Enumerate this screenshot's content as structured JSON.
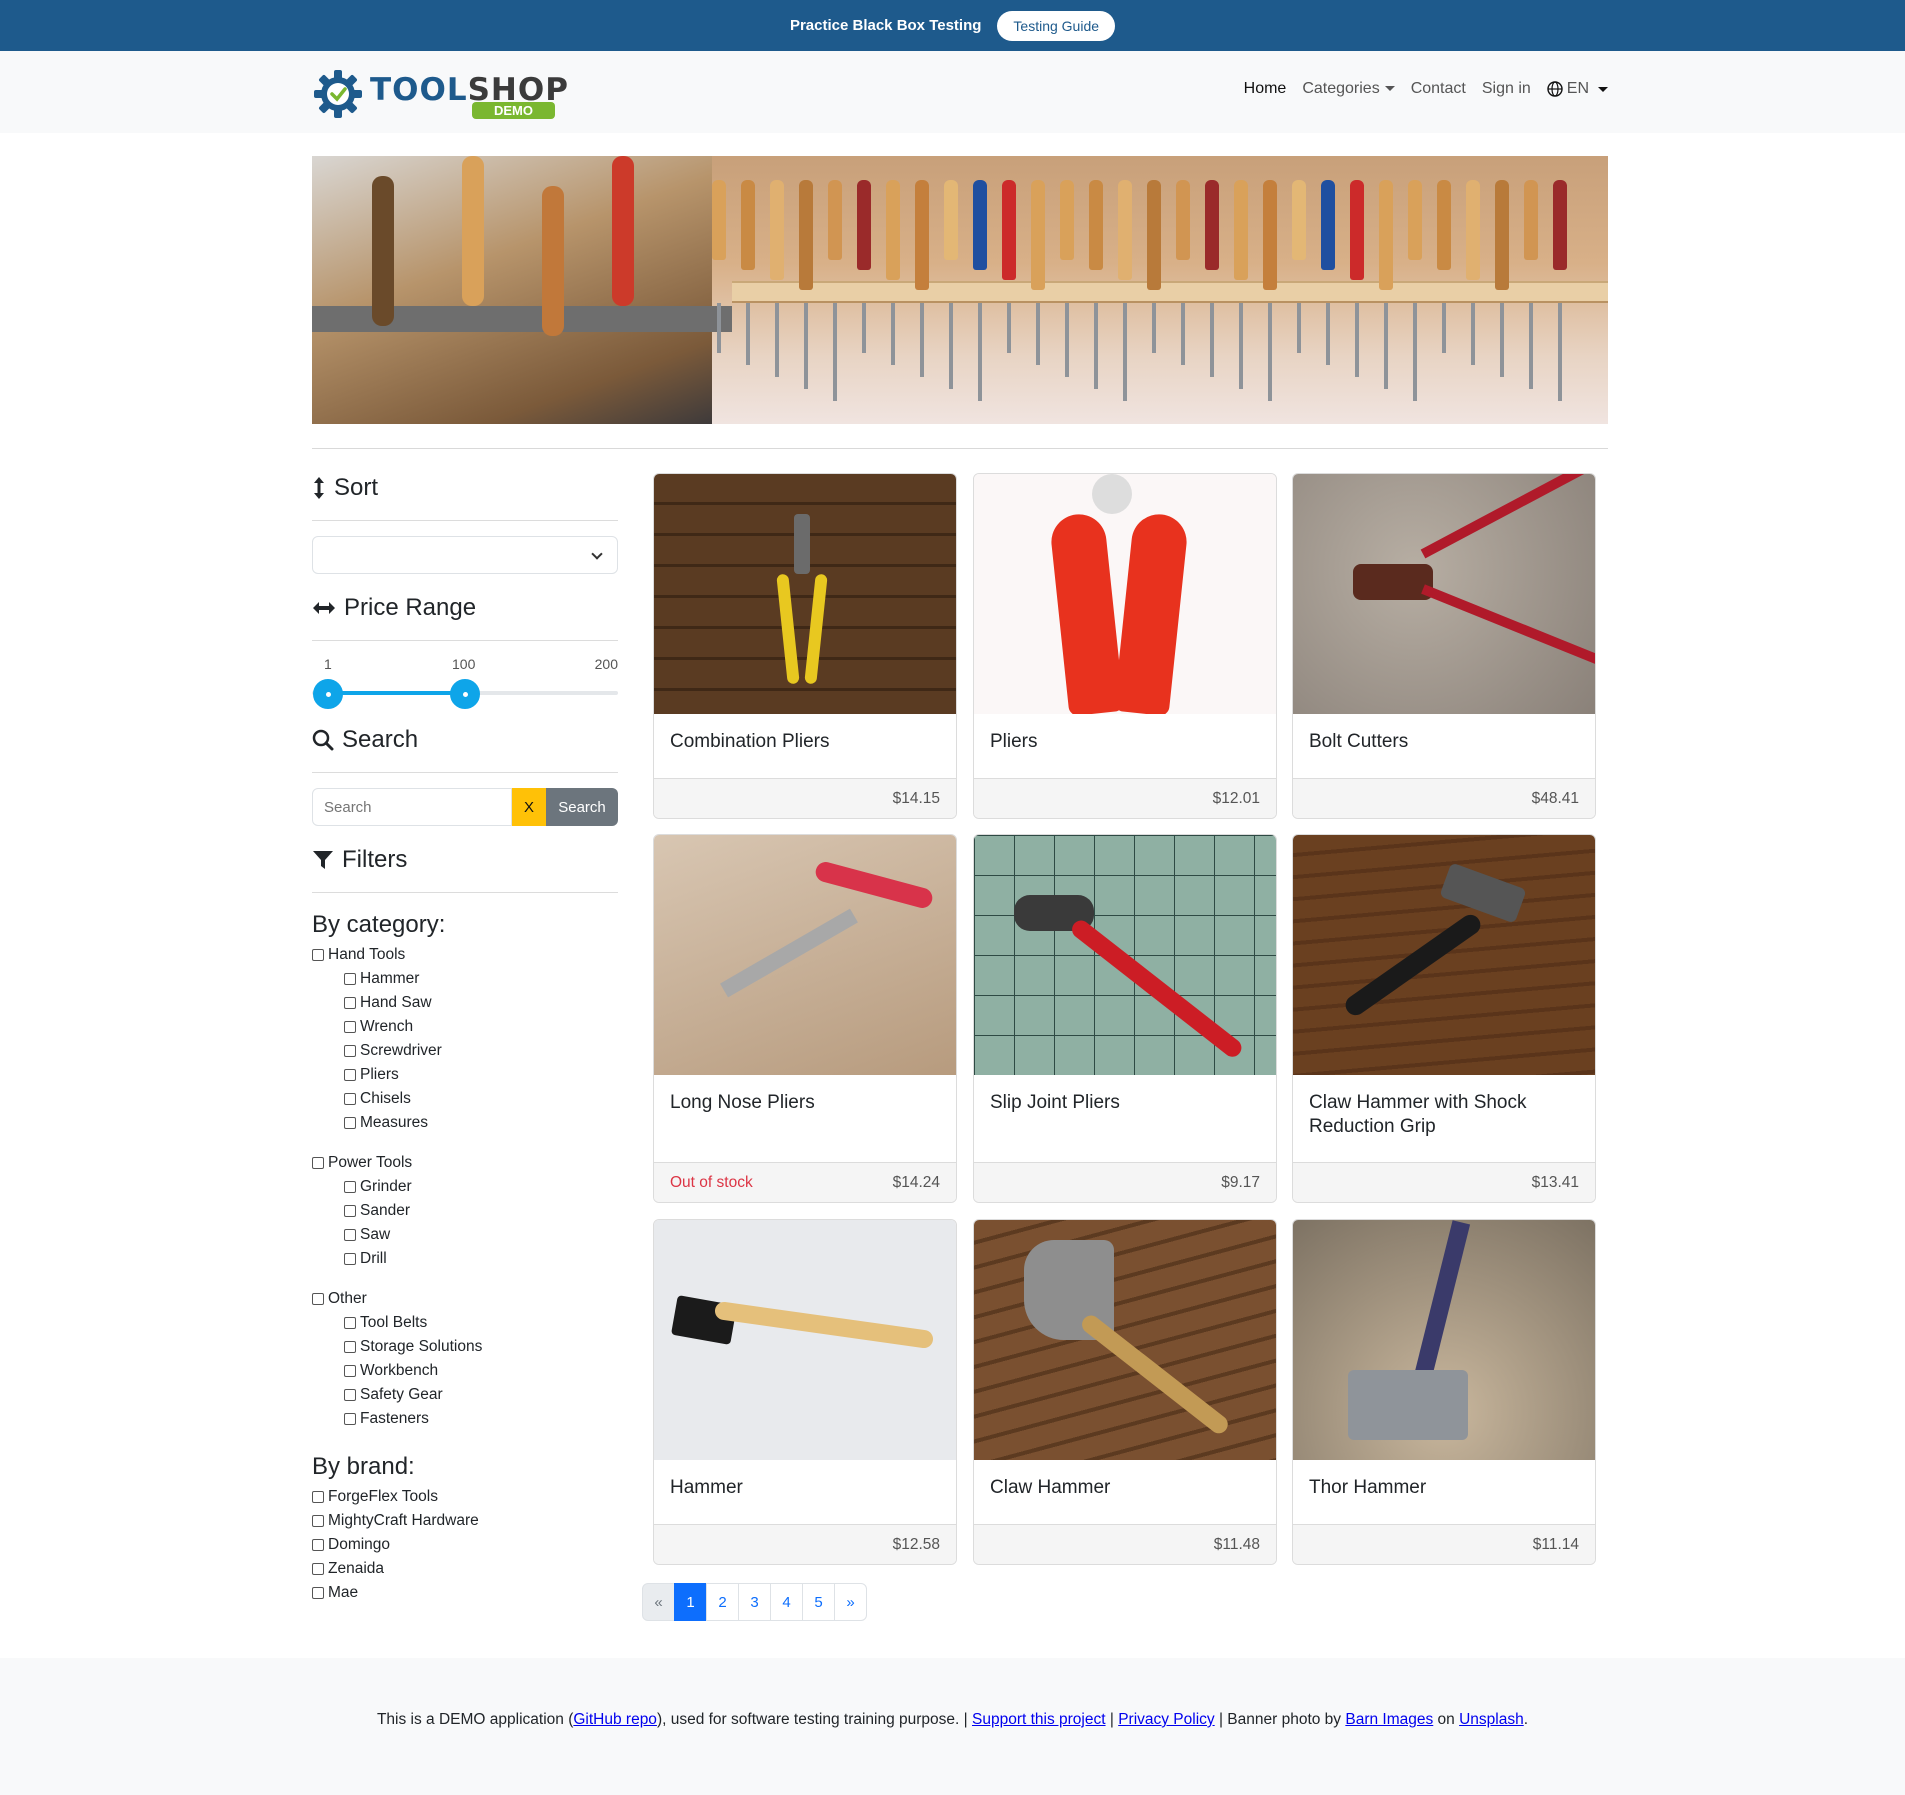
{
  "topbar": {
    "text": "Practice Black Box Testing",
    "button": "Testing Guide"
  },
  "logo": {
    "part1": "TOOL",
    "part2": "SHOP",
    "badge": "DEMO"
  },
  "nav": {
    "home": "Home",
    "categories": "Categories",
    "contact": "Contact",
    "signin": "Sign in",
    "lang": "EN"
  },
  "sidebar": {
    "sort_title": "Sort",
    "price_title": "Price Range",
    "price": {
      "min_label": "1",
      "max_sel": "100",
      "max_label": "200",
      "min_value": 1,
      "max_value": 100
    },
    "search_title": "Search",
    "search_placeholder": "Search",
    "clear_label": "X",
    "search_btn": "Search",
    "filters_title": "Filters",
    "by_category": "By category:",
    "categories": {
      "hand": {
        "label": "Hand Tools",
        "subs": [
          "Hammer",
          "Hand Saw",
          "Wrench",
          "Screwdriver",
          "Pliers",
          "Chisels",
          "Measures"
        ]
      },
      "power": {
        "label": "Power Tools",
        "subs": [
          "Grinder",
          "Sander",
          "Saw",
          "Drill"
        ]
      },
      "other": {
        "label": "Other",
        "subs": [
          "Tool Belts",
          "Storage Solutions",
          "Workbench",
          "Safety Gear",
          "Fasteners"
        ]
      }
    },
    "by_brand": "By brand:",
    "brands": [
      "ForgeFlex Tools",
      "MightyCraft Hardware",
      "Domingo",
      "Zenaida",
      "Mae"
    ]
  },
  "products": [
    {
      "name": "Combination Pliers",
      "price": "$14.15",
      "stock": ""
    },
    {
      "name": "Pliers",
      "price": "$12.01",
      "stock": ""
    },
    {
      "name": "Bolt Cutters",
      "price": "$48.41",
      "stock": ""
    },
    {
      "name": "Long Nose Pliers",
      "price": "$14.24",
      "stock": "Out of stock"
    },
    {
      "name": "Slip Joint Pliers",
      "price": "$9.17",
      "stock": ""
    },
    {
      "name": "Claw Hammer with Shock Reduction Grip",
      "price": "$13.41",
      "stock": ""
    },
    {
      "name": "Hammer",
      "price": "$12.58",
      "stock": ""
    },
    {
      "name": "Claw Hammer",
      "price": "$11.48",
      "stock": ""
    },
    {
      "name": "Thor Hammer",
      "price": "$11.14",
      "stock": ""
    }
  ],
  "pagination": {
    "prev": "«",
    "pages": [
      "1",
      "2",
      "3",
      "4",
      "5"
    ],
    "next": "»"
  },
  "footer": {
    "t1": "This is a DEMO application (",
    "github": "GitHub repo",
    "t2": "), used for software testing training purpose. | ",
    "support": "Support this project",
    "t3": " | ",
    "privacy": "Privacy Policy",
    "t4": " | Banner photo by ",
    "barn": "Barn Images",
    "t5": " on ",
    "unsplash": "Unsplash",
    "t6": "."
  }
}
